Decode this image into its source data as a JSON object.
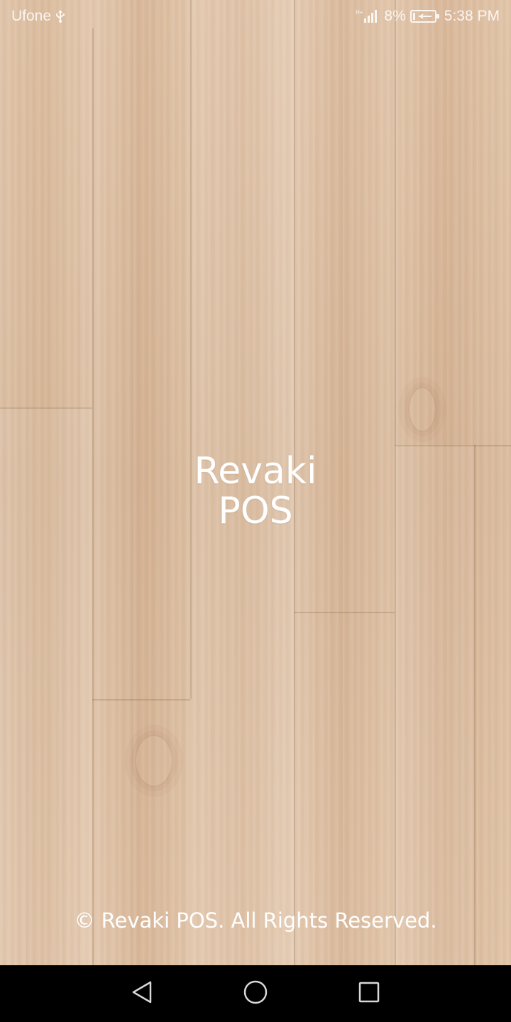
{
  "status_bar": {
    "carrier": "Ufone",
    "battery_percent": "8%",
    "time": "5:38 PM",
    "icons": [
      "usb-icon",
      "signal-icon",
      "battery-charging-icon"
    ]
  },
  "app": {
    "title_line1": "Revaki",
    "title_line2": "POS"
  },
  "footer": {
    "copyright": "© Revaki POS. All Rights Reserved."
  },
  "nav_bar": {
    "icons": [
      "back-icon",
      "home-icon",
      "recents-icon"
    ]
  },
  "colors": {
    "wood_base": "#dcbc9e",
    "text": "#ffffff",
    "nav_background": "#000000"
  }
}
